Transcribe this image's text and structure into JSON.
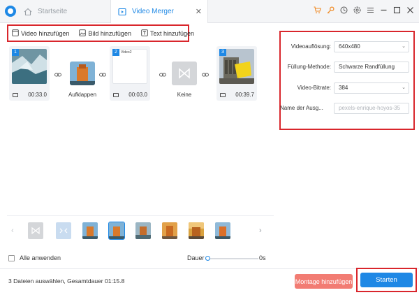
{
  "titlebar": {
    "tabs": [
      {
        "label": "Startseite",
        "icon": "home-icon"
      },
      {
        "label": "Video Merger",
        "icon": "video-merger-icon"
      }
    ],
    "close_tab": "✕",
    "icons": [
      "cart-icon",
      "key-icon",
      "clock-icon",
      "settings-icon",
      "menu-icon"
    ],
    "window_controls": [
      "minimize-icon",
      "maximize-icon",
      "close-icon"
    ]
  },
  "toolbar": {
    "add_video": "Video hinzufügen",
    "add_image": "Bild hinzufügen",
    "add_text": "Text hinzufügen"
  },
  "timeline": {
    "clips": [
      {
        "index": "1",
        "duration": "00:33.0"
      },
      {
        "index": "2",
        "duration": "00:03.0",
        "mini_label": "Video2"
      },
      {
        "index": "3",
        "duration": "00:39.7"
      }
    ],
    "transitions": [
      {
        "label": "Aufklappen"
      },
      {
        "label": "Keine"
      }
    ]
  },
  "settings": {
    "resolution": {
      "label": "Videoauflösung:",
      "value": "640x480"
    },
    "fill_method": {
      "label": "Füllung-Methode:",
      "value": "Schwarze Randfüllung"
    },
    "bitrate": {
      "label": "Video-Bitrate:",
      "value": "384"
    },
    "output_name": {
      "label": "Name der Ausg...",
      "placeholder": "pexels-enrique-hoyos-35"
    }
  },
  "controls": {
    "apply_all": "Alle anwenden",
    "duration_label": "Dauer",
    "duration_value": "0s"
  },
  "footer": {
    "status": "3 Dateien auswählen, Gesamtdauer 01:15.8",
    "montage_button": "Montage hinzufügen",
    "start_button": "Starten"
  },
  "colors": {
    "accent": "#1e88e5",
    "highlight": "#d9262c",
    "montage": "#f27c73"
  }
}
